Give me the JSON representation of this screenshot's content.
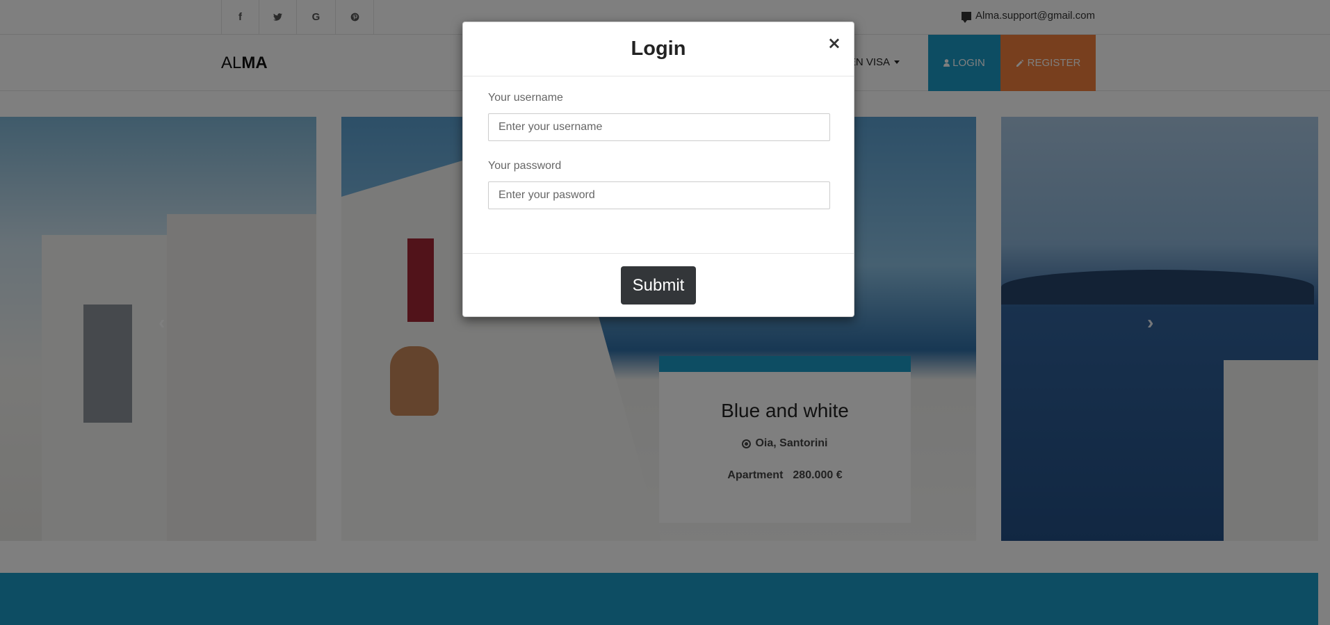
{
  "topbar": {
    "social": [
      {
        "icon": "facebook-icon",
        "glyph": "f"
      },
      {
        "icon": "twitter-icon",
        "glyph": "🐦"
      },
      {
        "icon": "google-icon",
        "glyph": "G"
      },
      {
        "icon": "pinterest-icon",
        "glyph": "℗"
      }
    ],
    "contact_icon": "comment-icon",
    "email": "Alma.support@gmail.com"
  },
  "navbar": {
    "brand_light": "AL",
    "brand_bold": "MA",
    "golden_visa_partial": "DEN VISA",
    "login_label": "LOGIN",
    "login_icon": "user-icon",
    "register_label": "REGISTER",
    "register_icon": "pencil-icon"
  },
  "carousel": {
    "card": {
      "title": "Blue and white",
      "location_icon": "location-icon",
      "location": "Oia, Santorini",
      "type": "Apartment",
      "price": "280.000 €"
    },
    "indicators": 3,
    "active_indicator": 0
  },
  "modal": {
    "title": "Login",
    "close_glyph": "×",
    "username_label": "Your username",
    "username_placeholder": "Enter your username",
    "username_value": "",
    "password_label": "Your password",
    "password_placeholder": "Enter your pasword",
    "password_value": "",
    "submit_label": "Submit"
  },
  "colors": {
    "accent_blue": "#1a9bc7",
    "accent_orange": "#f07f3c",
    "dark_button": "#333639"
  }
}
